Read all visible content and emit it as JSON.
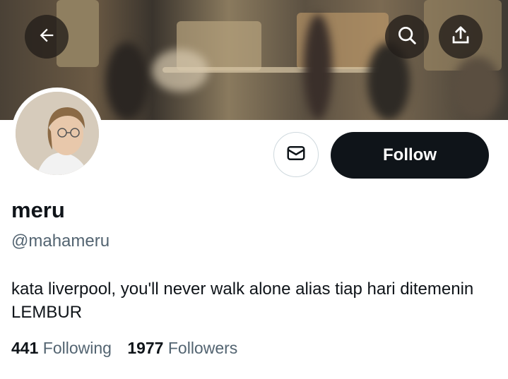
{
  "header": {
    "back_icon": "arrow-left-icon",
    "search_icon": "search-icon",
    "share_icon": "share-upload-icon"
  },
  "profile": {
    "display_name": "meru",
    "handle": "@mahameru",
    "bio": "kata liverpool, you'll never walk alone alias tiap hari ditemenin LEMBUR"
  },
  "actions": {
    "message_icon": "envelope-icon",
    "follow_label": "Follow"
  },
  "stats": {
    "following_count": "441",
    "following_label": "Following",
    "followers_count": "1977",
    "followers_label": "Followers"
  },
  "colors": {
    "follow_button_bg": "#0f1419",
    "secondary_text": "#536471",
    "border": "#cfd9de"
  }
}
